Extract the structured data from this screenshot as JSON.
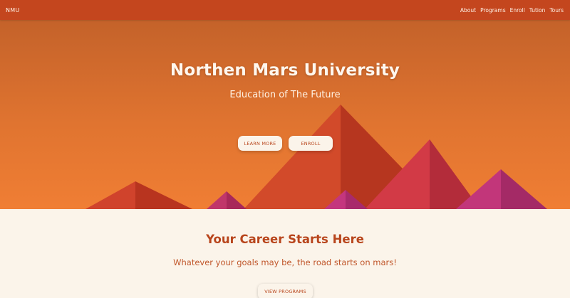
{
  "nav": {
    "brand": "NMU",
    "links": [
      "About",
      "Programs",
      "Enroll",
      "Tution",
      "Tours"
    ]
  },
  "hero": {
    "title": "Northen Mars University",
    "subtitle": "Education of The Future",
    "buttons": {
      "learn_more": "LEARN MORE",
      "enroll": "ENROLL"
    }
  },
  "career": {
    "title": "Your Career Starts Here",
    "tagline": "Whatever your goals may be, the road starts on mars!",
    "button": "VIEW PROGRAMS"
  },
  "colors": {
    "navbar": "#c4461e",
    "hero_top": "#c4622a",
    "hero_bottom": "#f07e34",
    "background": "#fbf4ea",
    "accent_text": "#b8451c"
  }
}
